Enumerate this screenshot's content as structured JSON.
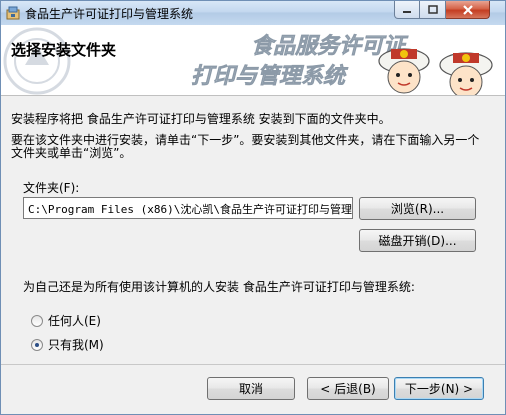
{
  "window": {
    "title": "食品生产许可证打印与管理系统",
    "icon": "installer-app-icon",
    "controls": {
      "minimize_icon": "minimize-icon",
      "maximize_icon": "maximize-icon",
      "close_icon": "close-icon"
    }
  },
  "header": {
    "title": "选择安装文件夹",
    "banner_line1": "食品服务许可证",
    "banner_line2": "打印与管理系统"
  },
  "content": {
    "intro": "安装程序将把 食品生产许可证打印与管理系统 安装到下面的文件夹中。",
    "instructions": "要在该文件夹中进行安装，请单击“下一步”。要安装到其他文件夹，请在下面输入另一个文件夹或单击“浏览”。",
    "folder_label": "文件夹(F):",
    "folder_value": "C:\\Program Files (x86)\\沈心凯\\食品生产许可证打印与管理系",
    "browse_label": "浏览(R)...",
    "disk_cost_label": "磁盘开销(D)...",
    "install_for_label": "为自己还是为所有使用该计算机的人安装 食品生产许可证打印与管理系统:",
    "options": [
      {
        "label": "任何人(E)",
        "selected": false
      },
      {
        "label": "只有我(M)",
        "selected": true
      }
    ]
  },
  "footer": {
    "cancel_label": "取消",
    "back_label": "< 后退(B)",
    "next_label": "下一步(N) >"
  },
  "colors": {
    "titlebar": "#c3d8ef",
    "close_button": "#c43d22",
    "default_button_border": "#3c7fb1",
    "banner_text": "#9aa9b8"
  }
}
